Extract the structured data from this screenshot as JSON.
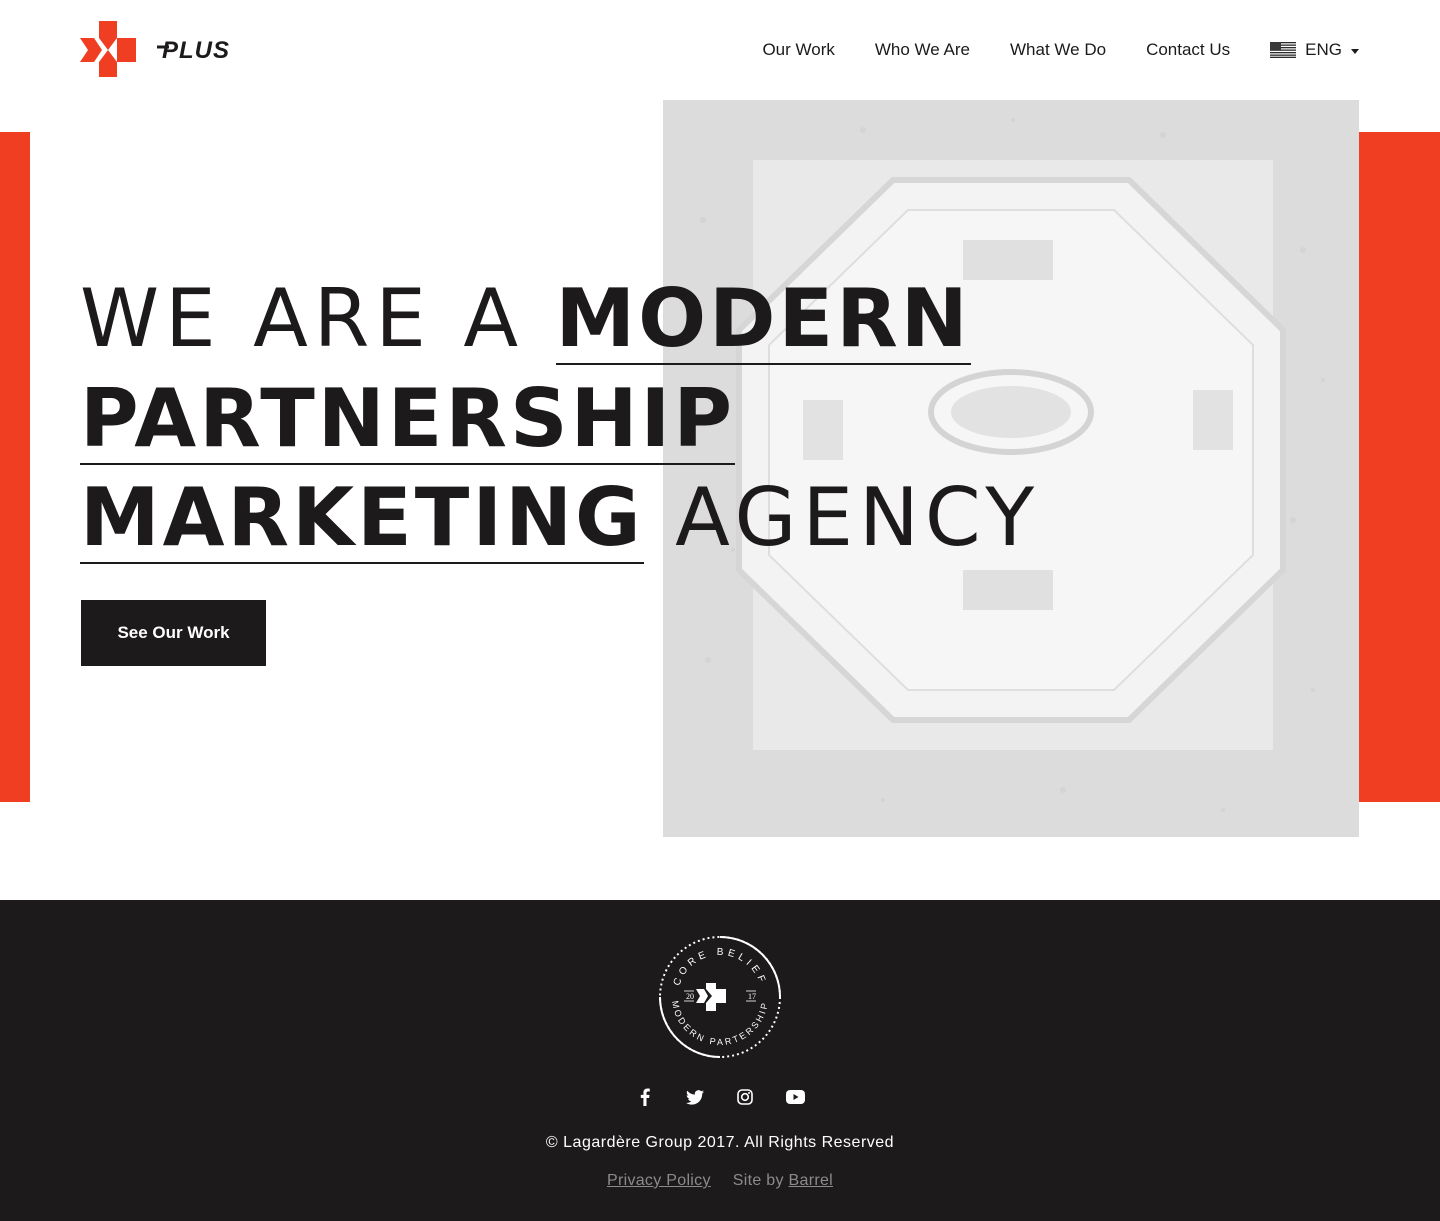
{
  "brand": {
    "logo_text": "PLUS",
    "accent_color": "#ef3e22",
    "dark_color": "#1c1a1b"
  },
  "nav": {
    "items": [
      {
        "label": "Our Work"
      },
      {
        "label": "Who We Are"
      },
      {
        "label": "What We Do"
      },
      {
        "label": "Contact Us"
      }
    ],
    "language": {
      "label": "ENG",
      "icon": "us-flag-icon"
    }
  },
  "hero": {
    "line1_light": "WE ARE A ",
    "line1_bold": "MODERN",
    "line2_bold": "PARTNERSHIP",
    "line3_bold": "MARKETING",
    "line3_light": " AGENCY",
    "cta_label": "See Our Work"
  },
  "footer": {
    "badge": {
      "top_text": "CORE BELIEF",
      "bottom_text": "MODERN PARTERSHIP",
      "year_left": "20",
      "year_right": "17"
    },
    "social": [
      "facebook-icon",
      "twitter-icon",
      "instagram-icon",
      "youtube-icon"
    ],
    "copyright": "© Lagardère Group 2017. All Rights Reserved",
    "privacy_label": "Privacy Policy",
    "site_by_label": "Site by",
    "site_by_link": "Barrel"
  }
}
